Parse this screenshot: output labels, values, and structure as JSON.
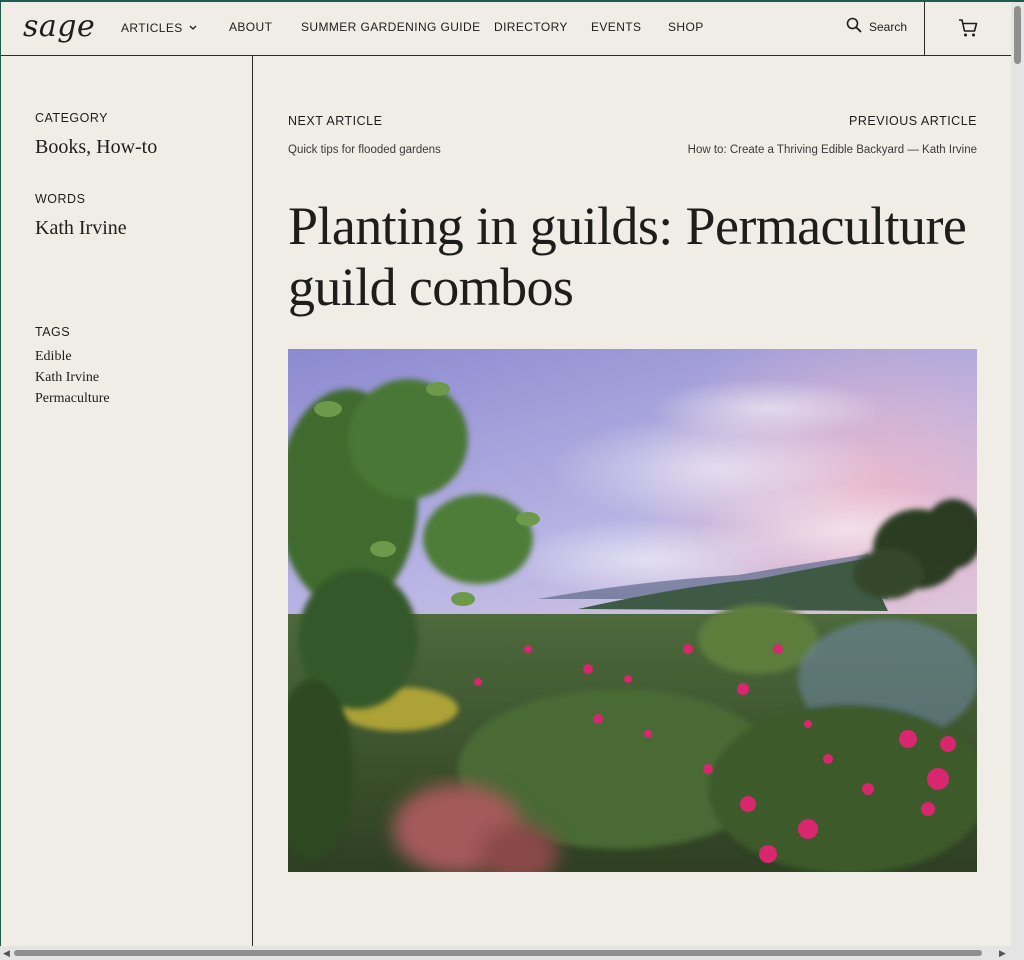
{
  "header": {
    "logo": "sage",
    "nav": [
      {
        "label": "ARTICLES",
        "has_dropdown": true
      },
      {
        "label": "ABOUT"
      },
      {
        "label": "SUMMER GARDENING GUIDE"
      },
      {
        "label": "DIRECTORY"
      },
      {
        "label": "EVENTS"
      },
      {
        "label": "SHOP"
      }
    ],
    "search_label": "Search",
    "icons": {
      "search": "search-icon",
      "cart": "cart-icon",
      "dropdown": "chevron-down-icon"
    }
  },
  "sidebar": {
    "category_label": "CATEGORY",
    "category_value": "Books, How-to",
    "words_label": "WORDS",
    "words_value": "Kath Irvine",
    "tags_label": "TAGS",
    "tags": [
      "Edible",
      "Kath Irvine",
      "Permaculture"
    ]
  },
  "article": {
    "next_label": "NEXT ARTICLE",
    "next_title": "Quick tips for flooded gardens",
    "prev_label": "PREVIOUS ARTICLE",
    "prev_title": "How to: Create a Thriving Edible Backyard — Kath Irvine",
    "title": "Planting in guilds: Permaculture guild combos"
  },
  "colors": {
    "page_background": "#efede6",
    "text": "#1d1d1b",
    "rule": "#2a2a2a",
    "window_frame": "#1e5a4e"
  }
}
